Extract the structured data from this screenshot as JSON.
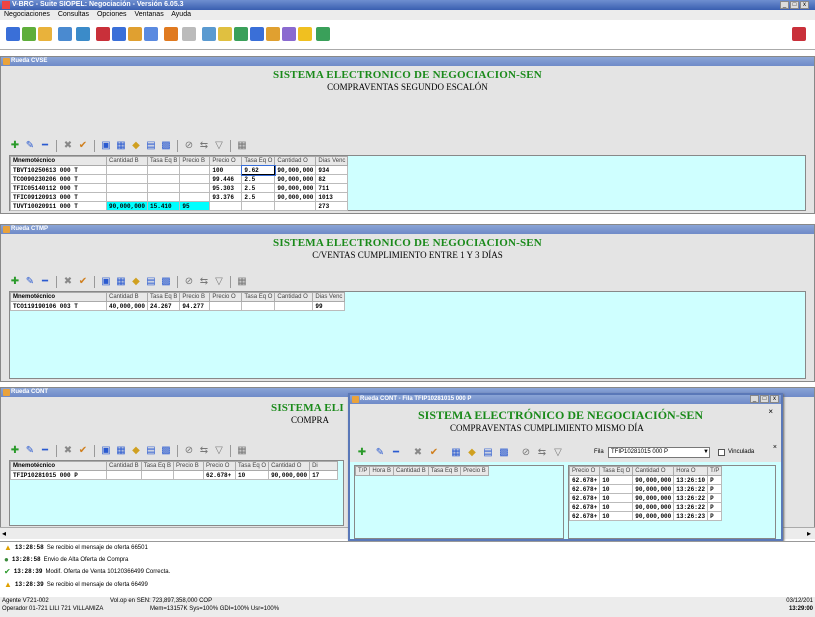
{
  "app": {
    "title": "V-BRC - Suite SIOPEL: Negociación - Versión 6.05.3"
  },
  "menu": [
    "Negociaciones",
    "Consultas",
    "Opciones",
    "Ventanas",
    "Ayuda"
  ],
  "panels": [
    {
      "title": "Rueda CVSE",
      "banner1": "SISTEMA ELECTRONICO DE NEGOCIACION-SEN",
      "banner2": "COMPRAVENTAS SEGUNDO ESCALÓN",
      "headers": [
        "Mnemotécnico",
        "Cantidad B",
        "Tasa Eq B",
        "Precio B",
        "Precio O",
        "Tasa Eq O",
        "Cantidad O",
        "Dias Venc"
      ],
      "rows": [
        [
          "TBVT10250613 000 T",
          "",
          "",
          "",
          "100",
          "9.62",
          "90,000,000",
          "934"
        ],
        [
          "TCO090230206 000 T",
          "",
          "",
          "",
          "99.446",
          "2.5",
          "90,000,000",
          "82"
        ],
        [
          "TFIC05140112 000 T",
          "",
          "",
          "",
          "95.303",
          "2.5",
          "90,000,000",
          "711"
        ],
        [
          "TFIC09120913 000 T",
          "",
          "",
          "",
          "93.376",
          "2.5",
          "90,000,000",
          "1013"
        ],
        [
          "TUVT10020911 000 T",
          "90,000,000",
          "15.410",
          "95",
          "",
          "",
          "",
          "273"
        ]
      ]
    },
    {
      "title": "Rueda CTMP",
      "banner1": "SISTEMA ELECTRONICO DE NEGOCIACION-SEN",
      "banner2": "C/VENTAS CUMPLIMIENTO ENTRE 1 Y 3 DÍAS",
      "headers": [
        "Mnemotécnico",
        "Cantidad B",
        "Tasa Eq B",
        "Precio B",
        "Precio O",
        "Tasa Eq O",
        "Cantidad O",
        "Dias Venc"
      ],
      "rows": [
        [
          "TCO119190106 003 T",
          "40,000,000",
          "24.267",
          "94.277",
          "",
          "",
          "",
          "99"
        ]
      ]
    },
    {
      "title": "Rueda CONT",
      "banner1": "SISTEMA ELI",
      "banner2": "COMPRA",
      "headers": [
        "Mnemotécnico",
        "Cantidad B",
        "Tasa Eq B",
        "Precio B",
        "Precio O",
        "Tasa Eq O",
        "Cantidad O",
        "Di"
      ],
      "rows": [
        [
          "TFIP10281015 000 P",
          "",
          "",
          "",
          "62.678+",
          "10",
          "90,000,000",
          "17"
        ]
      ]
    }
  ],
  "float": {
    "title": "Rueda CONT - Fila TFIP10281015 000 P",
    "banner1": "SISTEMA ELECTRÓNICO DE NEGOCIACIÓN-SEN",
    "banner2": "COMPRAVENTAS CUMPLIMIENTO MISMO DÍA",
    "fila_label": "Fila",
    "fila_value": "TFIP10281015 000 P",
    "vinculada": "Vinculada",
    "left_headers": [
      "T/P",
      "Hora B",
      "Cantidad B",
      "Tasa Eq B",
      "Precio B"
    ],
    "right_headers": [
      "Precio O",
      "Tasa Eq O",
      "Cantidad O",
      "Hora O",
      "T/P"
    ],
    "rows": [
      [
        "62.678+",
        "10",
        "90,000,000",
        "13:26:10",
        "P"
      ],
      [
        "62.678+",
        "10",
        "90,000,000",
        "13:26:22",
        "P"
      ],
      [
        "62.678+",
        "10",
        "90,000,000",
        "13:26:22",
        "P"
      ],
      [
        "62.678+",
        "10",
        "90,000,000",
        "13:26:22",
        "P"
      ],
      [
        "62.678+",
        "10",
        "90,000,000",
        "13:26:23",
        "P"
      ]
    ]
  },
  "messages": [
    {
      "time": "13:28:58",
      "text": "Se recibio el mensaje de oferta 66501",
      "icon": "warning-icon"
    },
    {
      "time": "13:28:58",
      "text": "Envio de Alta Oferta de Compra",
      "icon": "send-icon"
    },
    {
      "time": "13:28:39",
      "text": "Modif. Oferta de Venta 10120366499 Correcta.",
      "icon": "check-icon"
    },
    {
      "time": "13:28:39",
      "text": "Se recibio el mensaje de oferta 66499",
      "icon": "warning-icon"
    }
  ],
  "footer": {
    "agent": "Agente V721-002",
    "operator": "Operador 01-721 LILI 721 VILLAMIZA",
    "vol": "Vol.op en SEN: 723,897,358,000 COP",
    "mem": "Mem=13157K Sys=100% GDI=100% Usr=100%",
    "date": "03/12/201",
    "clock": "13:29:00"
  }
}
